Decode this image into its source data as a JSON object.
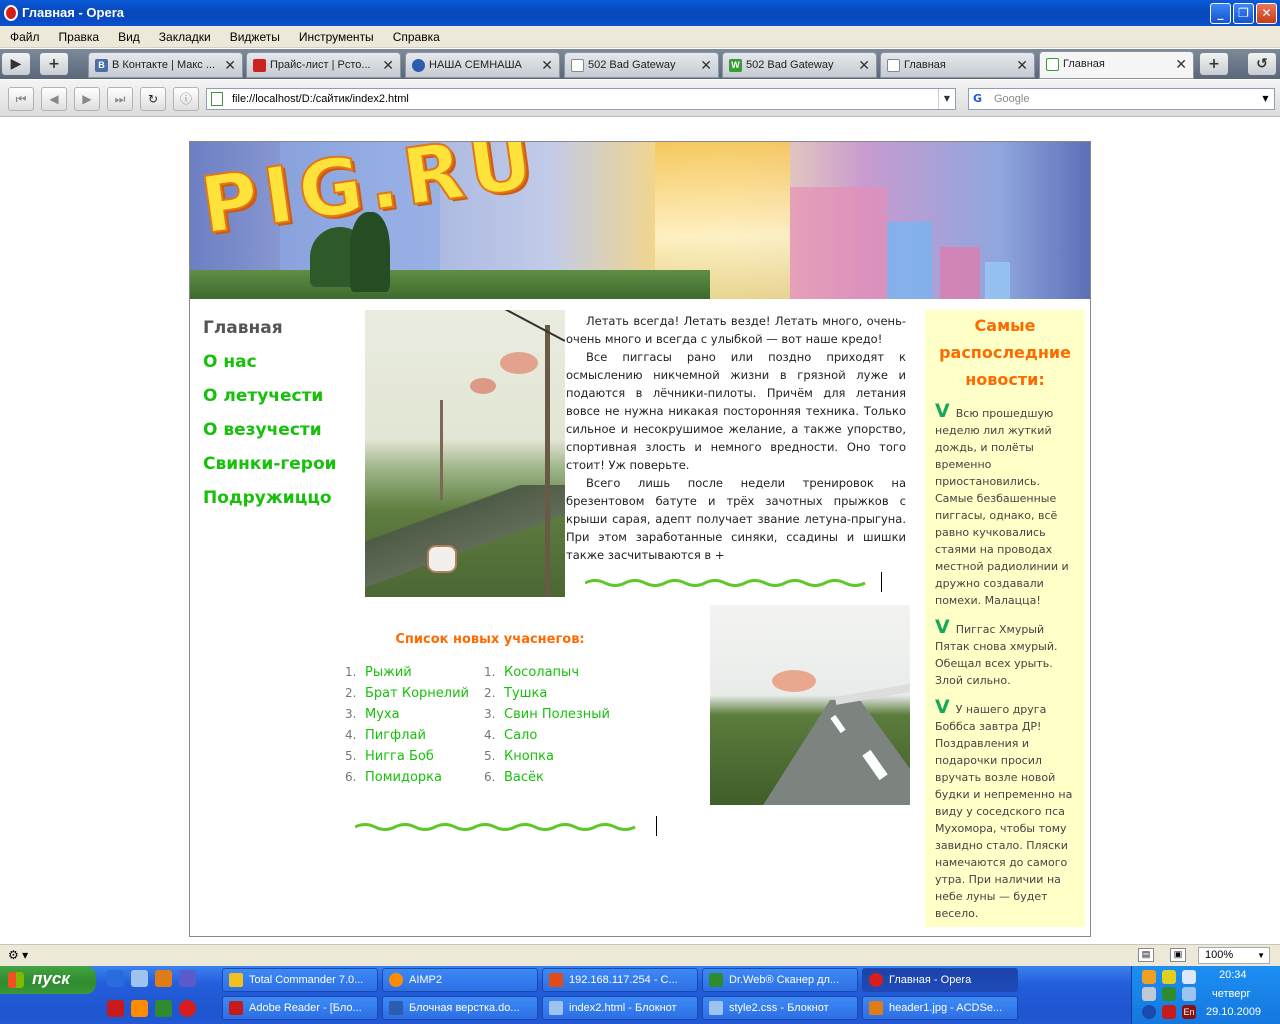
{
  "window": {
    "title": "Главная - Opera",
    "minimize": "_",
    "maximize": "❐",
    "close": "✕"
  },
  "menu": [
    "Файл",
    "Правка",
    "Вид",
    "Закладки",
    "Виджеты",
    "Инструменты",
    "Справка"
  ],
  "tabs": [
    {
      "label": "В Контакте | Макс ...",
      "icon": "B",
      "color": "#4a6ea8"
    },
    {
      "label": "Прайс-лист | Рсто...",
      "icon": "",
      "color": "#cc2222"
    },
    {
      "label": "НАША СЕМНАША",
      "icon": "",
      "color": "#2a5db0"
    },
    {
      "label": "502 Bad Gateway",
      "icon": "",
      "color": "#888888"
    },
    {
      "label": "502 Bad Gateway",
      "icon": "W",
      "color": "#3a9a3a"
    },
    {
      "label": "Главная",
      "icon": "",
      "color": "#888888"
    },
    {
      "label": "Главная",
      "icon": "",
      "color": "#3a9a3a",
      "active": true
    }
  ],
  "tab_close": "✕",
  "address": {
    "url": "file://localhost/D:/сайтик/index2.html",
    "search_placeholder": "Google",
    "dropdown": "▼"
  },
  "site": {
    "logo": "PIG.RU",
    "nav": [
      {
        "label": "Главная",
        "current": true
      },
      {
        "label": "О нас"
      },
      {
        "label": "О летучести"
      },
      {
        "label": "О везучести"
      },
      {
        "label": "Свинки-герои"
      },
      {
        "label": "Подружиццо"
      }
    ],
    "text": [
      "Летать всегда! Летать везде! Летать много, очень-очень много и всегда с улыбкой — вот наше кредо!",
      "Все пиггасы рано или поздно приходят к осмыслению никчемной жизни в грязной луже и подаются в лёчники-пилоты. Причём для летания вовсе не нужна никакая посторонняя техника. Только сильное и несокрушимое желание, а также упорство, спортивная злость и немного вредности. Оно того стоит! Уж поверьте.",
      "Всего лишь после недели тренировок на брезентовом батуте и трёх зачотных прыжков с крыши сарая, адепт получает звание летуна-прыгуна. При этом заработанные синяки, ссадины и шишки также засчитываются в +"
    ],
    "members_title": "Список новых учаснегов:",
    "members_left": [
      "Рыжий",
      "Брат Корнелий",
      "Муха",
      "Пигфлай",
      "Нигга Боб",
      "Помидорка"
    ],
    "members_right": [
      "Косолапыч",
      "Тушка",
      "Свин Полезный",
      "Сало",
      "Кнопка",
      "Васёк"
    ],
    "news_title": "Самые распоследние новости:",
    "news_marker": "V",
    "news": [
      "Всю прошедшую неделю лил жуткий дождь, и полёты временно приостановились. Самые безбашенные пиггасы, однако, всё равно кучковались стаями на проводах местной радиолинии и дружно создавали помехи. Малацца!",
      "Пиггас Хмурый Пятак снова хмурый. Обещал всех урыть. Злой сильно.",
      "У нашего друга Боббса завтра ДР! Поздравления и подарочки просил вручать возле новой будки и непременно на виду у соседского пса Мухомора, чтобы тому завидно стало. Пляски намечаются до самого утра. При наличии на небе луны — будет весело."
    ]
  },
  "status": {
    "zoom": "100%",
    "zoom_arrow": "▼"
  },
  "taskbar": {
    "start": "пуск",
    "tasks_top": [
      {
        "label": "Total Commander 7.0...",
        "color": "#f0c020"
      },
      {
        "label": "AIMP2",
        "color": "#ff8c00"
      },
      {
        "label": "192.168.117.254 - С...",
        "color": "#e04b1a"
      },
      {
        "label": "Dr.Web® Сканер дл...",
        "color": "#2e8b2e"
      },
      {
        "label": "Главная - Opera",
        "color": "#d91c1c",
        "active": true
      }
    ],
    "tasks_bottom": [
      {
        "label": "Adobe Reader - [Бло...",
        "color": "#c81a1a"
      },
      {
        "label": "Блочная верстка.do...",
        "color": "#2a5db0"
      },
      {
        "label": "index2.html - Блокнот",
        "color": "#9ec3f0"
      },
      {
        "label": "style2.css - Блокнот",
        "color": "#9ec3f0"
      },
      {
        "label": "header1.jpg - ACDSe...",
        "color": "#e07b1a"
      }
    ],
    "time": "20:34",
    "day": "четверг",
    "date": "29.10.2009"
  }
}
